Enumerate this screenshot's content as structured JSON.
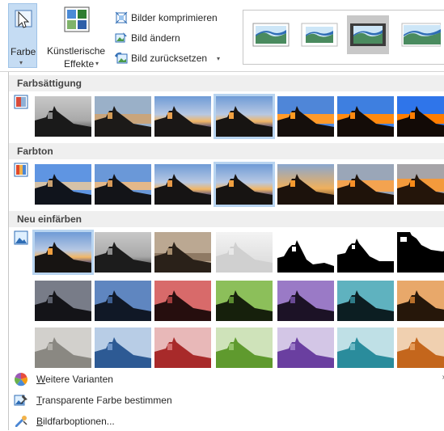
{
  "ribbon": {
    "farbe": {
      "label": "Farbe",
      "caret": "▾"
    },
    "kuenstlerische": {
      "line1": "Künstlerische",
      "line2": "Effekte",
      "caret": "▾"
    },
    "commands": [
      {
        "label": "Bilder komprimieren",
        "icon": "compress-icon"
      },
      {
        "label": "Bild ändern",
        "icon": "change-picture-icon"
      },
      {
        "label": "Bild zurücksetzen",
        "icon": "reset-picture-icon",
        "caret": "▾"
      }
    ],
    "styles_count": 4
  },
  "sections": [
    {
      "title": "Farbsättigung",
      "icon": "saturation-icon"
    },
    {
      "title": "Farbton",
      "icon": "tone-icon"
    },
    {
      "title": "Neu einfärben",
      "icon": "recolor-icon"
    }
  ],
  "menu": [
    {
      "accel": "W",
      "rest": "eitere Varianten",
      "icon": "more-variants-icon"
    },
    {
      "accel": "T",
      "rest": "ransparente Farbe bestimmen",
      "icon": "transparent-color-icon"
    },
    {
      "accel": "B",
      "rest": "ildfarboptionen...",
      "icon": "picture-color-options-icon"
    }
  ],
  "colors": {
    "accent": "#c5dcf3",
    "selected_outline": "#b8d4f0",
    "section_bg": "#efefef"
  }
}
